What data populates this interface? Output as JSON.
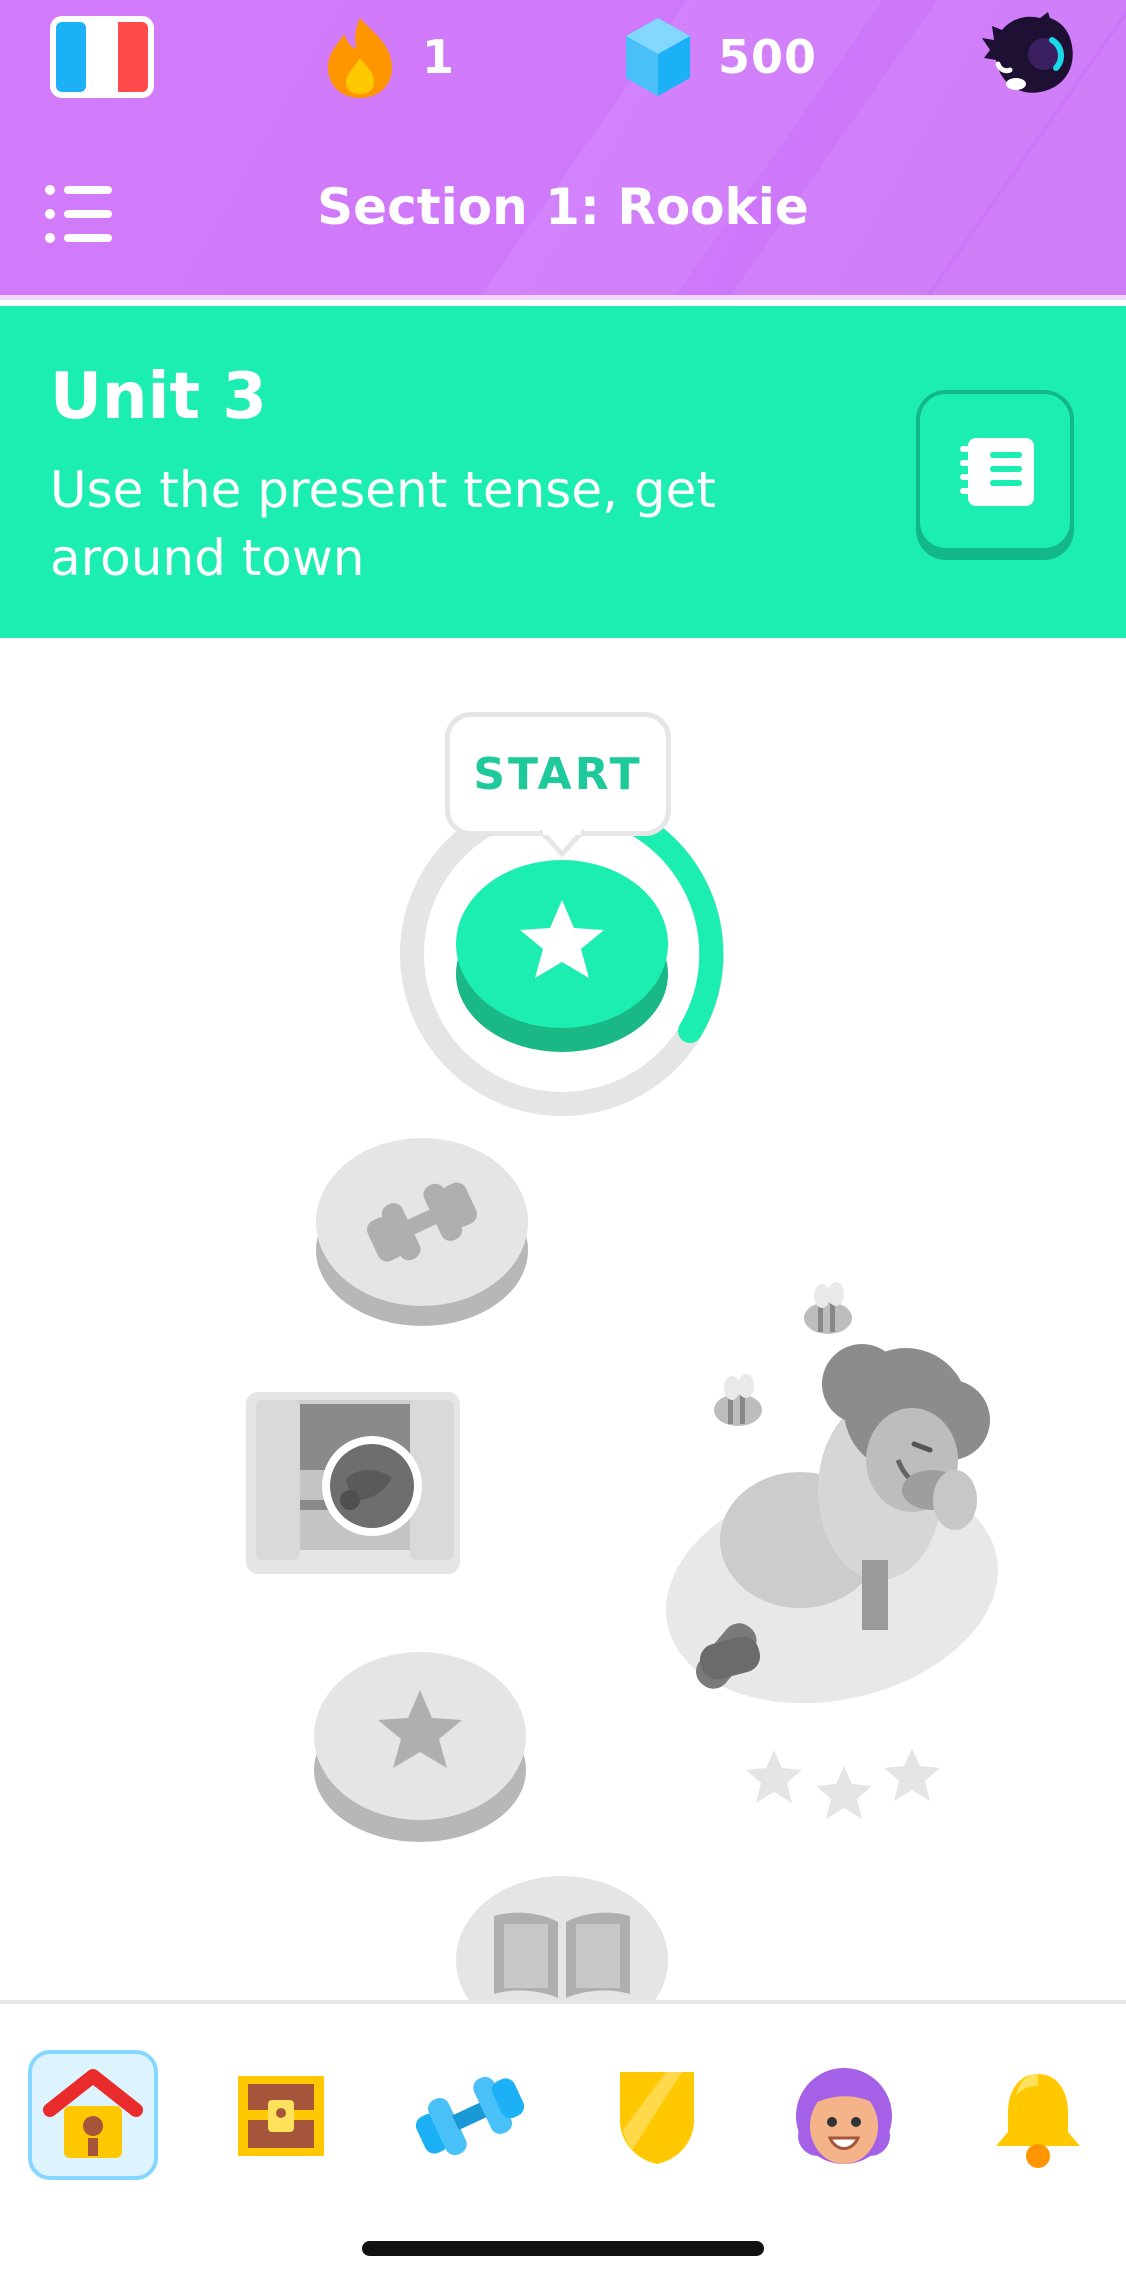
{
  "header": {
    "language_flag": "flag-icon",
    "streak_count": "1",
    "gems_count": "500",
    "section_title": "Section 1: Rookie"
  },
  "unit": {
    "title": "Unit 3",
    "description": "Use the present tense, get around town"
  },
  "path": {
    "start_label": "START",
    "nodes": [
      {
        "type": "lesson-star",
        "state": "current",
        "progress": 0.25
      },
      {
        "type": "practice-dumbbell",
        "state": "locked"
      },
      {
        "type": "treasure-chest",
        "state": "locked"
      },
      {
        "type": "lesson-star",
        "state": "locked"
      },
      {
        "type": "story-book",
        "state": "locked"
      }
    ],
    "character_stars": 3
  },
  "nav": {
    "items": [
      "home-icon",
      "treasure-chest-icon",
      "dumbbell-icon",
      "shield-icon",
      "profile-avatar-icon",
      "bell-icon"
    ],
    "active": "home-icon"
  },
  "colors": {
    "topbar": "#d27cfb",
    "unit_banner": "#1cedb1",
    "accent_green": "#1ec99a",
    "locked_gray": "#e5e5e5"
  }
}
